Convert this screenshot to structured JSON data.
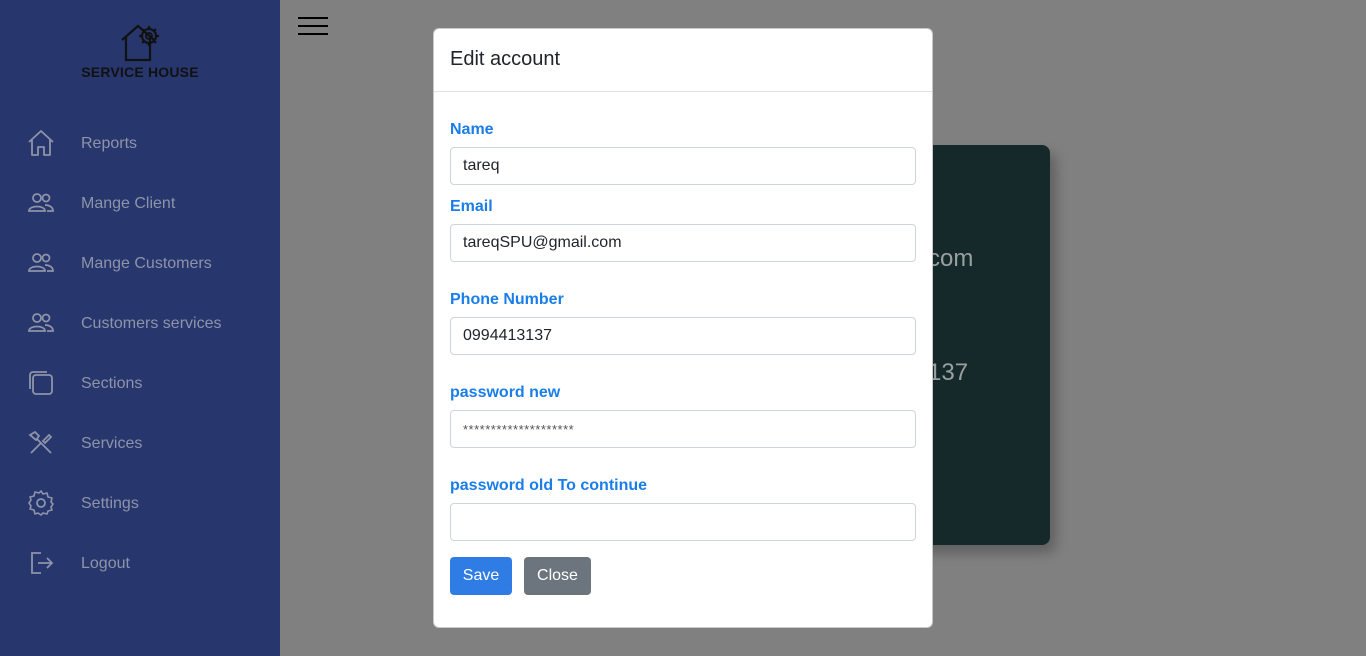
{
  "app": {
    "logo_text": "SERVICE HOUSE"
  },
  "sidebar": {
    "items": [
      {
        "label": "Reports",
        "icon": "home-icon"
      },
      {
        "label": "Mange Client",
        "icon": "users-icon"
      },
      {
        "label": "Mange Customers",
        "icon": "users-icon"
      },
      {
        "label": "Customers services",
        "icon": "users-icon"
      },
      {
        "label": "Sections",
        "icon": "layers-icon"
      },
      {
        "label": "Services",
        "icon": "tools-icon"
      },
      {
        "label": "Settings",
        "icon": "gear-icon"
      },
      {
        "label": "Logout",
        "icon": "logout-icon"
      }
    ]
  },
  "background_card": {
    "email_fragment": "com",
    "phone_fragment": "137"
  },
  "modal": {
    "title": "Edit account",
    "fields": {
      "name": {
        "label": "Name",
        "value": "tareq"
      },
      "email": {
        "label": "Email",
        "value": "tareqSPU@gmail.com"
      },
      "phone": {
        "label": "Phone Number",
        "value": "0994413137"
      },
      "password_new": {
        "label": "password new",
        "value": "********************"
      },
      "password_old": {
        "label": "password old To continue",
        "value": ""
      }
    },
    "buttons": {
      "save": "Save",
      "close": "Close"
    }
  },
  "colors": {
    "sidebar_bg": "#27376e",
    "label_blue": "#1a7ee8",
    "save_button": "#2f7ce4",
    "close_button": "#6c757d",
    "overlay": "#808080",
    "card_bg": "#15292a"
  }
}
